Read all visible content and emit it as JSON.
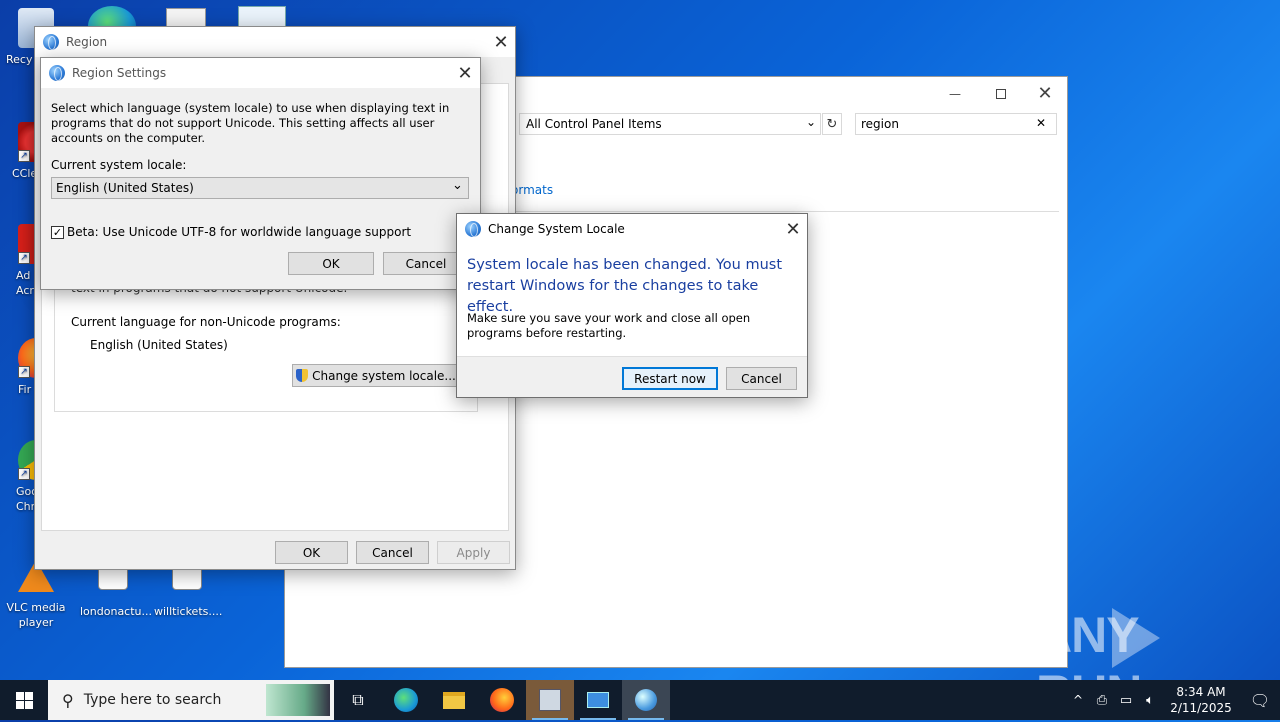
{
  "desktop": {
    "icons": [
      {
        "label": "Recy"
      },
      {
        "label": "CCle"
      },
      {
        "label": "Ad Acr"
      },
      {
        "label": "Fir"
      },
      {
        "label": "Goo Chr"
      },
      {
        "label": "VLC media player"
      },
      {
        "label": "londonactu..."
      },
      {
        "label": "willtickets...."
      }
    ]
  },
  "control_panel": {
    "address": "All Control Panel Items",
    "search_value": "region",
    "link_partial": "ormats"
  },
  "region_window": {
    "title": "Region",
    "partial_text": "text in programs that do not support Unicode.",
    "current_lang_label": "Current language for non-Unicode programs:",
    "current_lang_value": "English (United States)",
    "change_locale_button": "Change system locale...",
    "ok_label": "OK",
    "cancel_label": "Cancel",
    "apply_label": "Apply"
  },
  "region_settings": {
    "title": "Region Settings",
    "description": "Select which language (system locale) to use when displaying text in programs that do not support Unicode. This setting affects all user accounts on the computer.",
    "locale_label": "Current system locale:",
    "locale_value": "English (United States)",
    "beta_label": "Beta: Use Unicode UTF-8 for worldwide language support",
    "ok_label": "OK",
    "cancel_label": "Cancel"
  },
  "change_locale_dialog": {
    "title": "Change System Locale",
    "heading": "System locale has been changed. You must restart Windows for the changes to take effect.",
    "body": "Make sure you save your work and close all open programs before restarting.",
    "restart_label": "Restart now",
    "cancel_label": "Cancel"
  },
  "taskbar": {
    "search_placeholder": "Type here to search",
    "time": "8:34 AM",
    "date": "2/11/2025"
  },
  "watermark": "ANY RUN",
  "colors": {
    "accent": "#0078d7",
    "dialog_heading": "#1a3fa0",
    "link": "#0066cc",
    "taskbar": "#101c2c"
  }
}
